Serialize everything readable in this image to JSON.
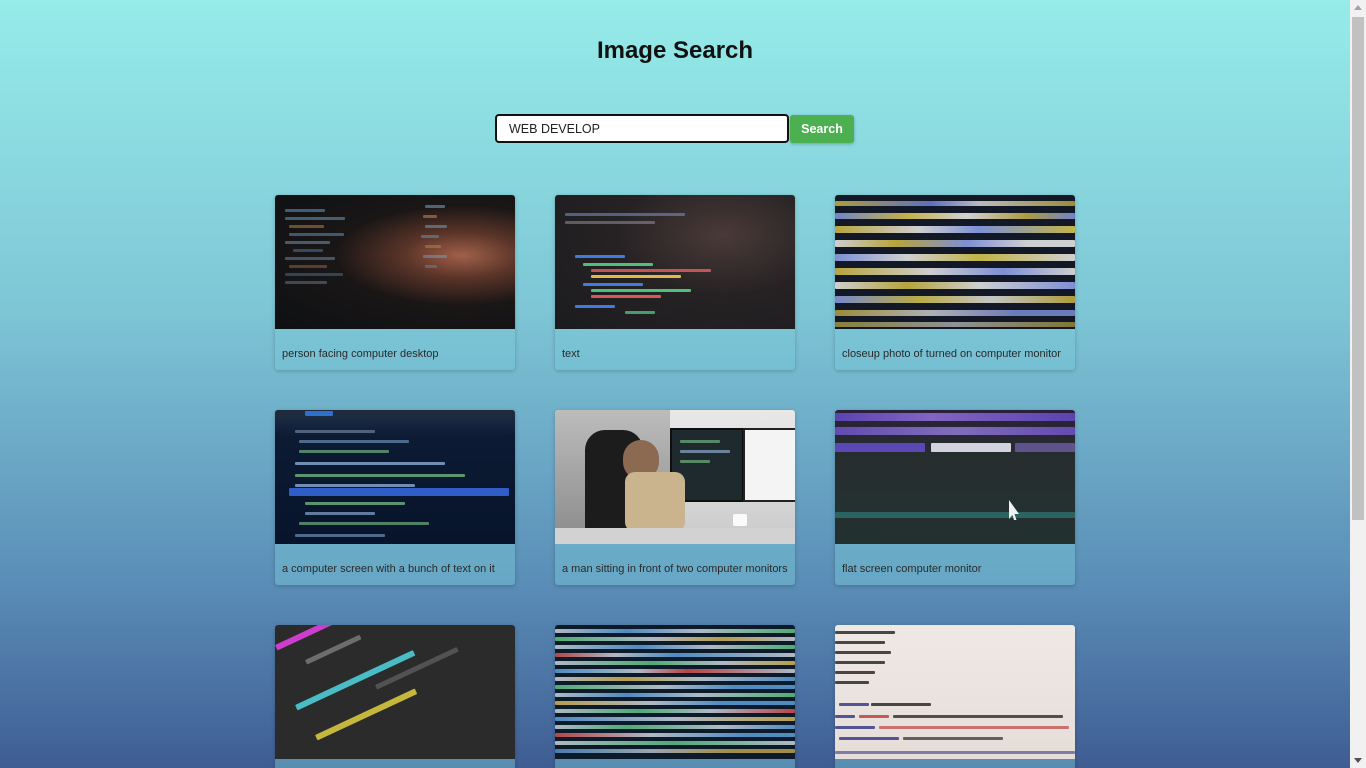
{
  "page": {
    "title": "Image Search"
  },
  "search": {
    "value": "WEB DEVELOP",
    "button_label": "Search"
  },
  "results": [
    {
      "caption": "person facing computer desktop"
    },
    {
      "caption": "text"
    },
    {
      "caption": "closeup photo of turned on computer monitor"
    },
    {
      "caption": "a computer screen with a bunch of text on it"
    },
    {
      "caption": "a man sitting in front of two computer monitors"
    },
    {
      "caption": "flat screen computer monitor"
    },
    {
      "caption": ""
    },
    {
      "caption": ""
    },
    {
      "caption": ""
    }
  ],
  "colors": {
    "accent": "#4caf50",
    "background_top": "#96ece9",
    "background_bottom": "#3f5d93"
  }
}
